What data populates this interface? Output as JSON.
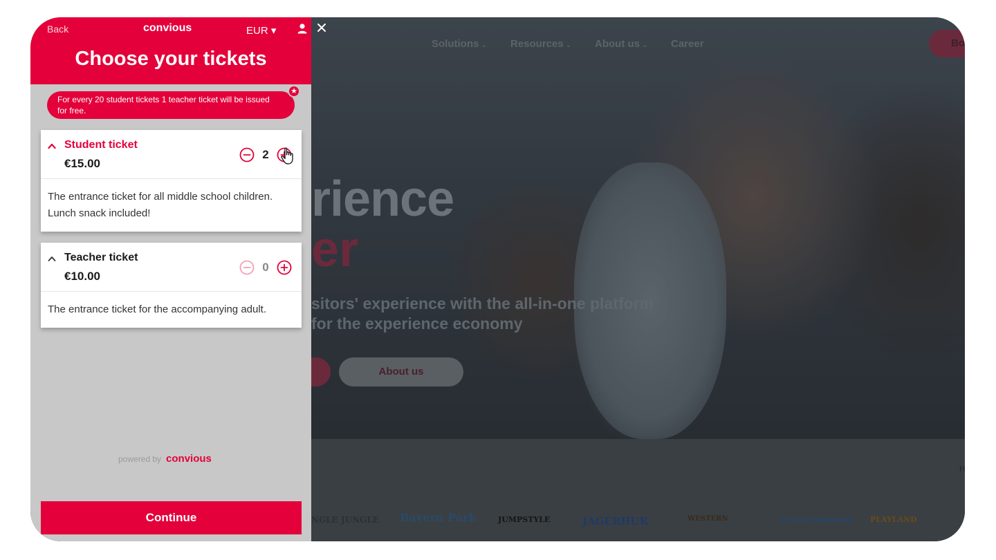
{
  "panel": {
    "back_label": "Back",
    "brand": "convious",
    "currency": "EUR ▾",
    "title": "Choose your tickets",
    "promo_text": "For every 20 student tickets 1 teacher ticket will be issued for free.",
    "tickets": [
      {
        "name": "Student ticket",
        "price": "€15.00",
        "quantity": "2",
        "description": "The entrance ticket for all middle school children. Lunch snack included!",
        "expanded": true
      },
      {
        "name": "Teacher ticket",
        "price": "€10.00",
        "quantity": "0",
        "description": "The entrance ticket for the accompanying adult.",
        "expanded": true
      }
    ],
    "powered_by": "powered by",
    "powered_brand": "convious",
    "continue_label": "Continue"
  },
  "site": {
    "nav": [
      "Solutions",
      "Resources",
      "About us",
      "Career"
    ],
    "nav_cta": "Bo",
    "hero_title_1": "rience",
    "hero_title_2": "er",
    "hero_sub_1": "sitors' experience with the all-in-one platform",
    "hero_sub_2": "for the experience economy",
    "hero_button": "About us",
    "logos": [
      "NGLE JUNGLE",
      "Bayern Park",
      "JUMPSTYLE",
      "JAGERHUK",
      "WESTERN",
      "Grand Aquarium",
      "PLAYLAND"
    ],
    "edge_text": "H"
  },
  "colors": {
    "accent": "#e4003a",
    "panel_bg": "#c8c8c8",
    "overlay": "#2d3338"
  },
  "icons": [
    "user-icon",
    "close-icon",
    "star-icon",
    "chevron-up-icon",
    "minus-circle-icon",
    "plus-circle-icon",
    "hand-cursor-icon"
  ]
}
